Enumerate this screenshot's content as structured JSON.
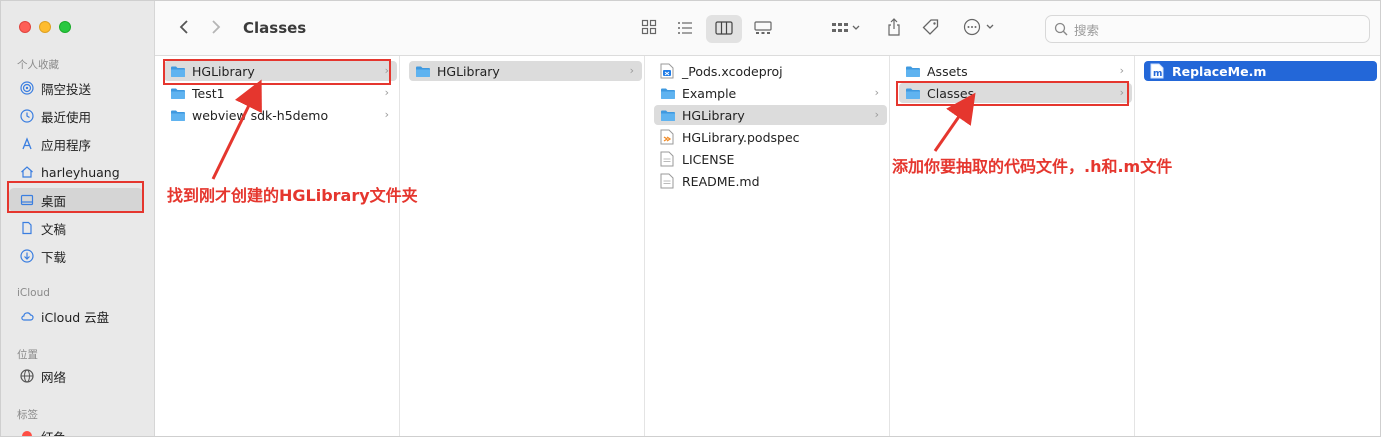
{
  "toolbar": {
    "title": "Classes",
    "search_placeholder": "搜索"
  },
  "sidebar": {
    "sections": {
      "favorites": "个人收藏",
      "icloud": "iCloud",
      "locations": "位置",
      "tags": "标签"
    },
    "items": [
      {
        "label": "隔空投送",
        "icon": "airdrop-icon"
      },
      {
        "label": "最近使用",
        "icon": "clock-icon"
      },
      {
        "label": "应用程序",
        "icon": "apps-icon"
      },
      {
        "label": "harleyhuang",
        "icon": "home-icon"
      },
      {
        "label": "桌面",
        "icon": "desktop-icon",
        "selected": true
      },
      {
        "label": "文稿",
        "icon": "document-icon"
      },
      {
        "label": "下载",
        "icon": "download-icon"
      },
      {
        "label": "iCloud 云盘",
        "icon": "cloud-icon"
      },
      {
        "label": "网络",
        "icon": "network-icon"
      },
      {
        "label": "红色",
        "icon": "red-tag-icon"
      }
    ]
  },
  "columns": [
    {
      "rows": [
        {
          "label": "HGLibrary",
          "type": "folder",
          "chevron": true,
          "state": "grey"
        },
        {
          "label": "Test1",
          "type": "folder",
          "chevron": true
        },
        {
          "label": "webview sdk-h5demo",
          "type": "folder",
          "chevron": true
        }
      ]
    },
    {
      "rows": [
        {
          "label": "HGLibrary",
          "type": "folder",
          "chevron": true,
          "state": "grey"
        }
      ]
    },
    {
      "rows": [
        {
          "label": "_Pods.xcodeproj",
          "type": "xcodeproj"
        },
        {
          "label": "Example",
          "type": "folder",
          "chevron": true
        },
        {
          "label": "HGLibrary",
          "type": "folder",
          "chevron": true,
          "state": "grey"
        },
        {
          "label": "HGLibrary.podspec",
          "type": "podspec"
        },
        {
          "label": "LICENSE",
          "type": "file"
        },
        {
          "label": "README.md",
          "type": "file"
        }
      ]
    },
    {
      "rows": [
        {
          "label": "Assets",
          "type": "folder",
          "chevron": true
        },
        {
          "label": "Classes",
          "type": "folder",
          "chevron": true,
          "state": "grey"
        }
      ]
    },
    {
      "rows": [
        {
          "label": "ReplaceMe.m",
          "type": "m-file",
          "state": "blue"
        }
      ]
    }
  ],
  "annotations": {
    "left": "找到刚才创建的HGLibrary文件夹",
    "right": "添加你要抽取的代码文件，.h和.m文件"
  },
  "colors": {
    "annotation_red": "#e5362e",
    "selection_blue": "#2367d8",
    "folder_blue": "#5fb3f0"
  }
}
